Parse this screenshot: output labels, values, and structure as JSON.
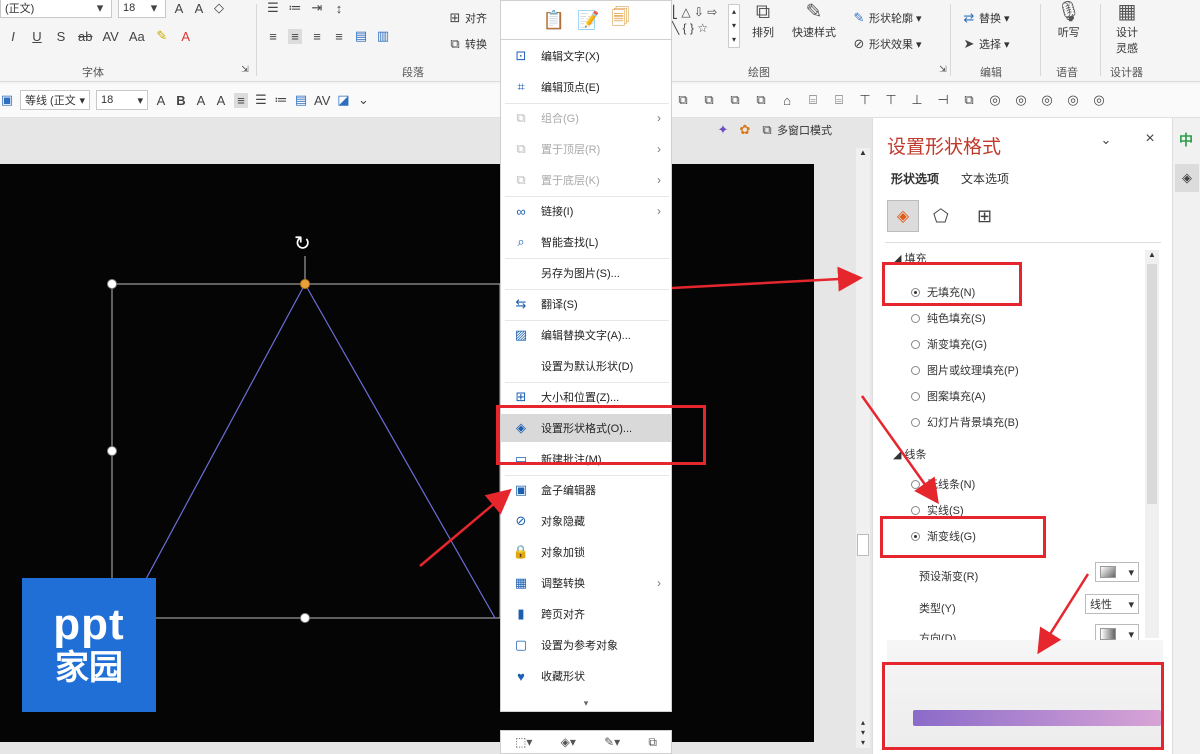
{
  "ribbon": {
    "font_name_partial": "(正文)",
    "font_size": "18",
    "font_group_label": "字体",
    "paragraph_group_label": "段落",
    "align_label": "对齐",
    "convert_label": "转换",
    "drawing_group_label": "绘图",
    "arrange_label": "排列",
    "quick_style_label": "快速样式",
    "shape_outline_label": "形状轮廓",
    "shape_effect_label": "形状效果",
    "replace_label": "替换",
    "select_label": "选择",
    "edit_group_label": "编辑",
    "dictate_label": "听写",
    "voice_group_label": "语音",
    "designer_label_1": "设计",
    "designer_label_2": "灵感",
    "designer_group_label": "设计器"
  },
  "minibar": {
    "font_name": "等线 (正文",
    "font_size": "18"
  },
  "view": {
    "multi_window_label": "多窗口模式"
  },
  "context_menu": {
    "items": [
      {
        "label": "编辑文字(X)",
        "icon": "text-box-icon",
        "disabled": false,
        "submenu": false
      },
      {
        "label": "编辑顶点(E)",
        "icon": "edit-points-icon",
        "disabled": false,
        "submenu": false
      },
      {
        "label": "组合(G)",
        "icon": "group-icon",
        "disabled": true,
        "submenu": true
      },
      {
        "label": "置于顶层(R)",
        "icon": "bring-front-icon",
        "disabled": true,
        "submenu": true
      },
      {
        "label": "置于底层(K)",
        "icon": "send-back-icon",
        "disabled": true,
        "submenu": true
      },
      {
        "label": "链接(I)",
        "icon": "link-icon",
        "disabled": false,
        "submenu": true
      },
      {
        "label": "智能查找(L)",
        "icon": "smart-lookup-icon",
        "disabled": false,
        "submenu": false
      },
      {
        "label": "另存为图片(S)...",
        "icon": "",
        "disabled": false,
        "submenu": false
      },
      {
        "label": "翻译(S)",
        "icon": "translate-icon",
        "disabled": false,
        "submenu": false
      },
      {
        "label": "编辑替换文字(A)...",
        "icon": "alt-text-icon",
        "disabled": false,
        "submenu": false
      },
      {
        "label": "设置为默认形状(D)",
        "icon": "",
        "disabled": false,
        "submenu": false
      },
      {
        "label": "大小和位置(Z)...",
        "icon": "size-position-icon",
        "disabled": false,
        "submenu": false
      },
      {
        "label": "设置形状格式(O)...",
        "icon": "format-shape-icon",
        "disabled": false,
        "submenu": false
      },
      {
        "label": "新建批注(M)",
        "icon": "comment-icon",
        "disabled": false,
        "submenu": false
      },
      {
        "label": "盒子编辑器",
        "icon": "box-editor-icon",
        "disabled": false,
        "submenu": false
      },
      {
        "label": "对象隐藏",
        "icon": "hide-icon",
        "disabled": false,
        "submenu": false
      },
      {
        "label": "对象加锁",
        "icon": "lock-icon",
        "disabled": false,
        "submenu": false
      },
      {
        "label": "调整转换",
        "icon": "convert-icon",
        "disabled": false,
        "submenu": true
      },
      {
        "label": "跨页对齐",
        "icon": "cross-align-icon",
        "disabled": false,
        "submenu": false
      },
      {
        "label": "设置为参考对象",
        "icon": "reference-icon",
        "disabled": false,
        "submenu": false
      },
      {
        "label": "收藏形状",
        "icon": "favorite-icon",
        "disabled": false,
        "submenu": false
      }
    ]
  },
  "pane": {
    "title": "设置形状格式",
    "tab_shape": "形状选项",
    "tab_text": "文本选项",
    "fill_section": "填充",
    "fill_options": [
      {
        "label": "无填充(N)",
        "selected": true
      },
      {
        "label": "纯色填充(S)",
        "selected": false
      },
      {
        "label": "渐变填充(G)",
        "selected": false
      },
      {
        "label": "图片或纹理填充(P)",
        "selected": false
      },
      {
        "label": "图案填充(A)",
        "selected": false
      },
      {
        "label": "幻灯片背景填充(B)",
        "selected": false
      }
    ],
    "line_section": "线条",
    "line_options": [
      {
        "label": "无线条(N)",
        "selected": false
      },
      {
        "label": "实线(S)",
        "selected": false
      },
      {
        "label": "渐变线(G)",
        "selected": true
      }
    ],
    "preset_gradient_label": "预设渐变(R)",
    "type_label": "类型(Y)",
    "type_value": "线性",
    "direction_label": "方向(D)"
  },
  "logo": {
    "line1": "ppt",
    "line2": "家园"
  },
  "strip": {
    "top_char": "中"
  },
  "colors": {
    "accent_red": "#e5262d",
    "pane_title": "#c0392b",
    "logo_blue": "#1f6fd6",
    "slide_bg": "#050505",
    "gradient_start": "#8b6bc9",
    "gradient_end": "#d8a4d6"
  }
}
